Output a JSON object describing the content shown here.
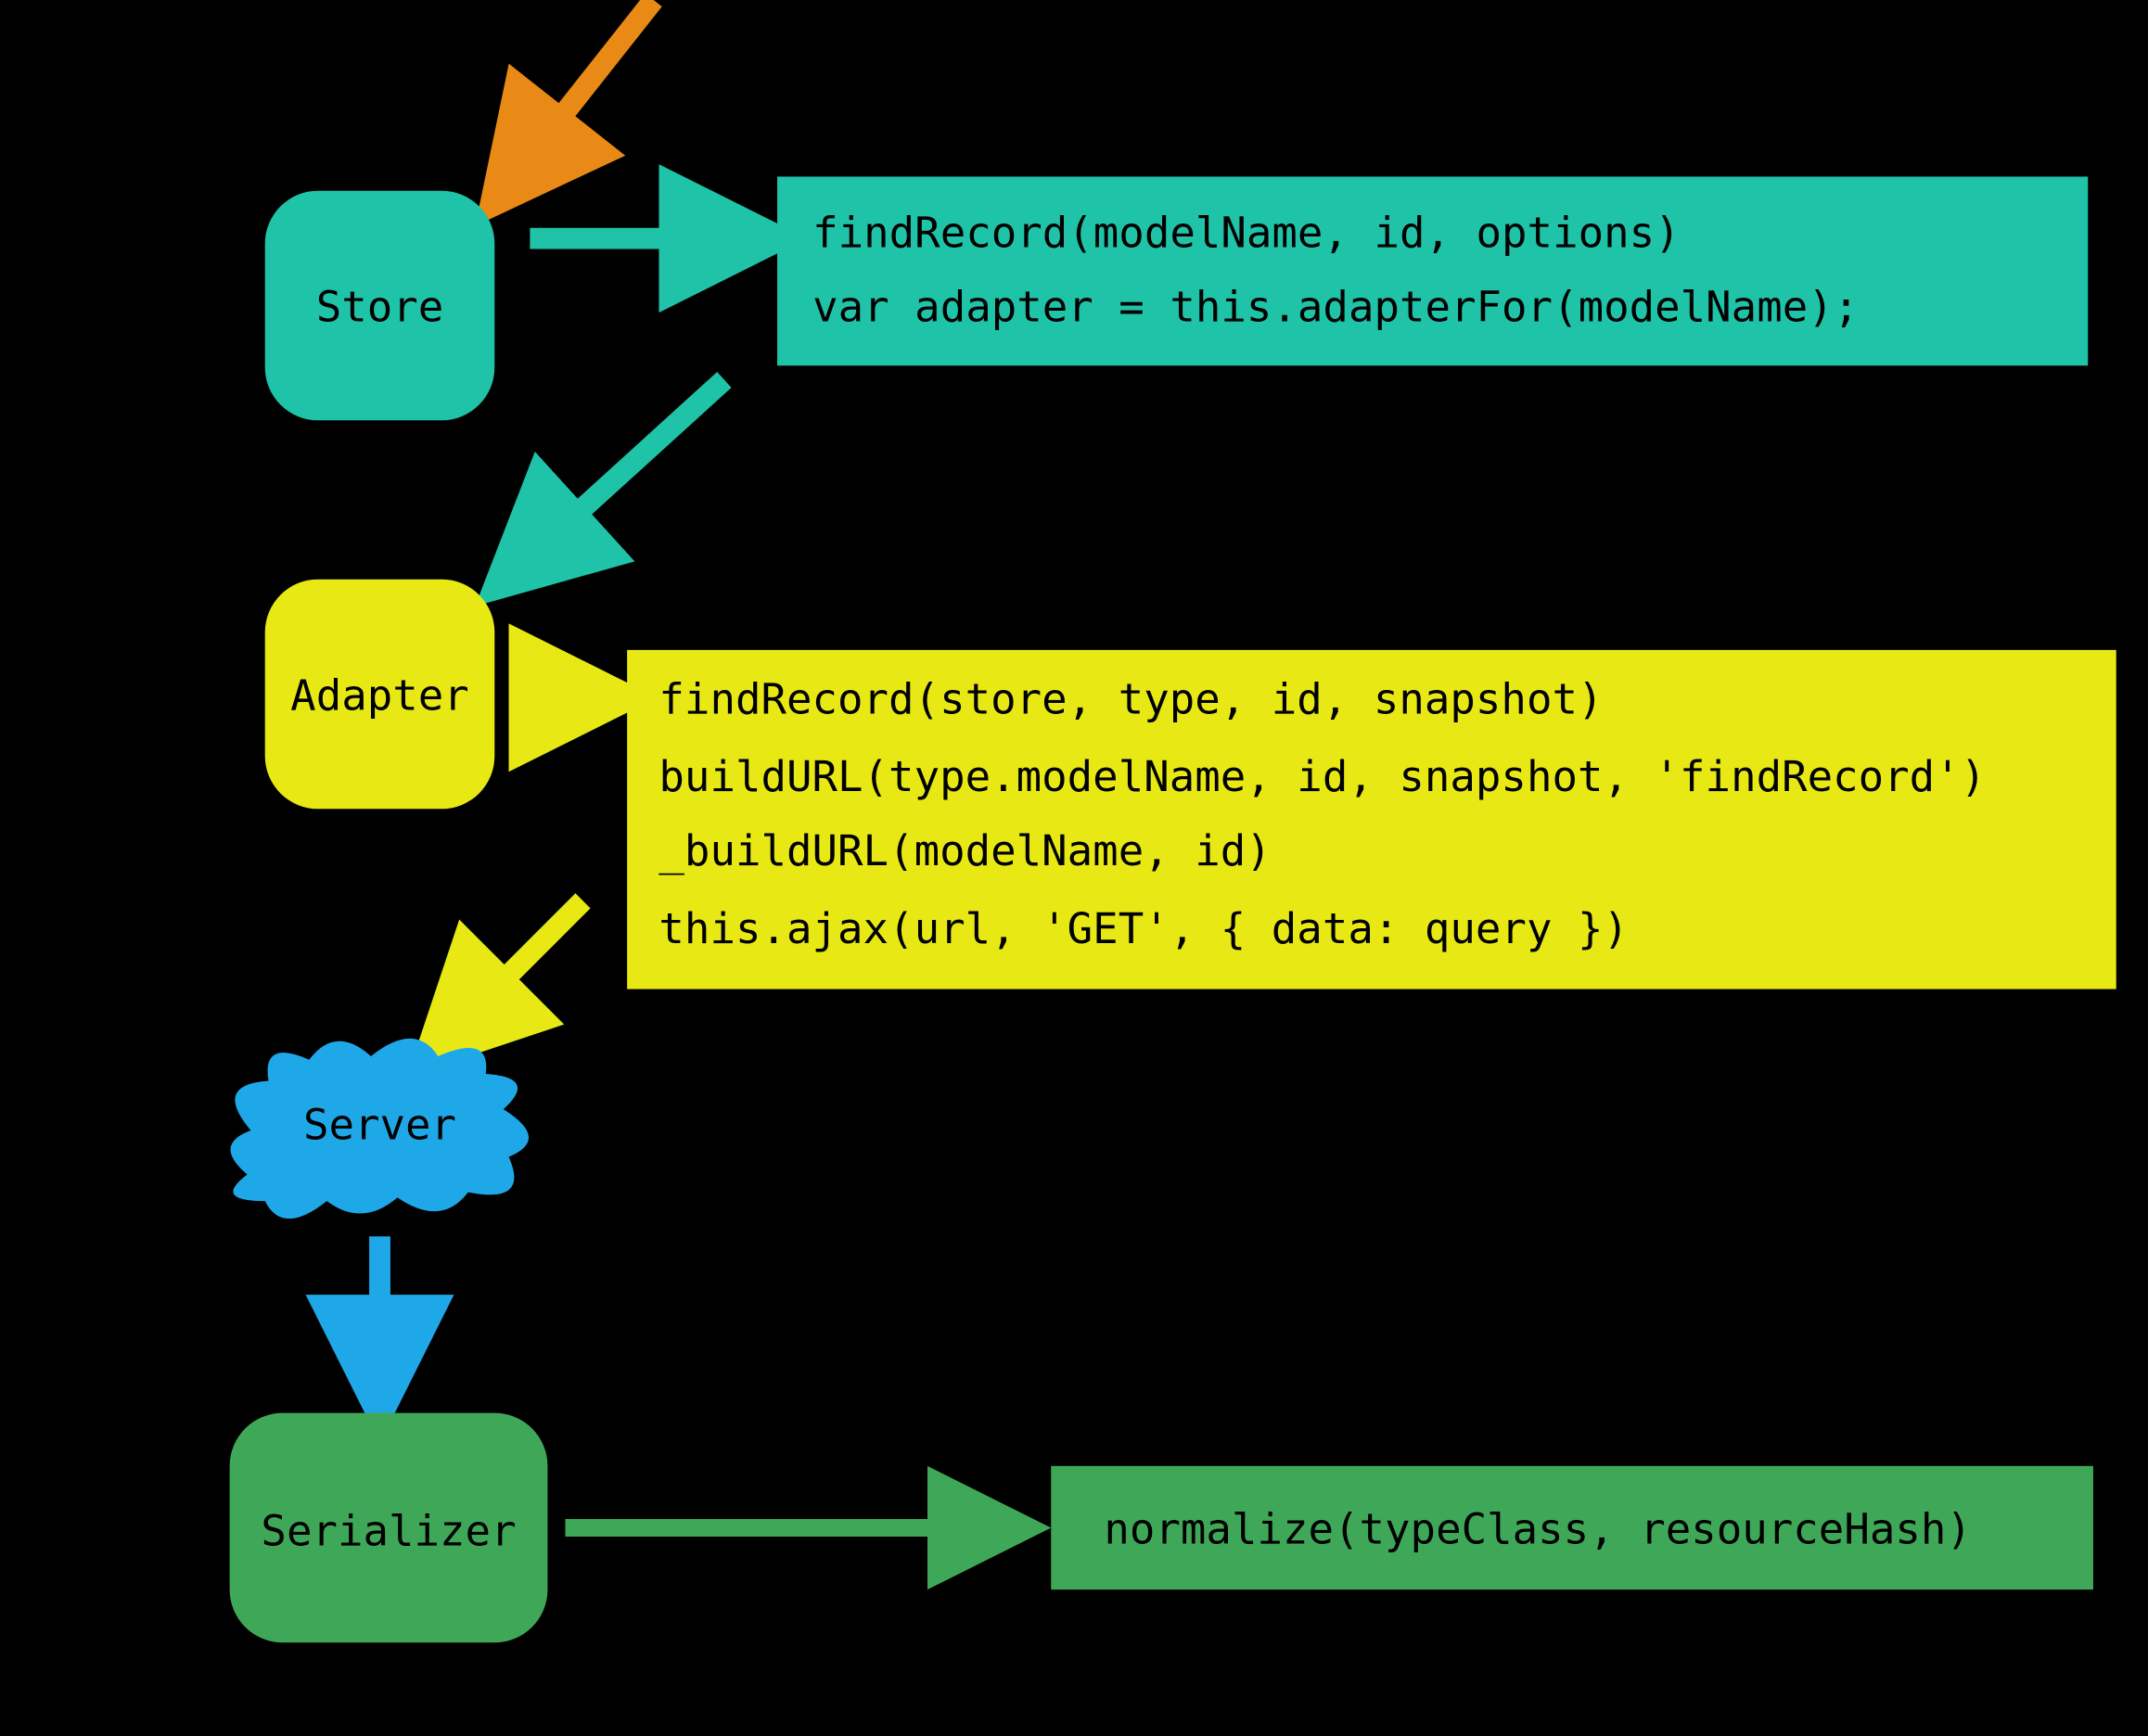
{
  "colors": {
    "teal": "#1FC3A8",
    "yellow": "#E8E815",
    "blue": "#1FA8E8",
    "green": "#3FA858",
    "orange": "#E88A15"
  },
  "nodes": {
    "store": {
      "label": "Store"
    },
    "adapter": {
      "label": "Adapter"
    },
    "server": {
      "label": "Server"
    },
    "serializer": {
      "label": "Serializer"
    }
  },
  "codeBoxes": {
    "store": {
      "lines": [
        "findRecord(modelName, id, options)",
        "  var adapter = this.adapterFor(modelName);"
      ]
    },
    "adapter": {
      "lines": [
        "findRecord(store, type, id, snapshot)",
        "buildURL(type.modelName, id, snapshot, 'findRecord')",
        "_buildURL(modelName, id)",
        "this.ajax(url, 'GET', { data: query })"
      ]
    },
    "serializer": {
      "lines": [
        "normalize(typeClass, resourceHash)"
      ]
    }
  }
}
